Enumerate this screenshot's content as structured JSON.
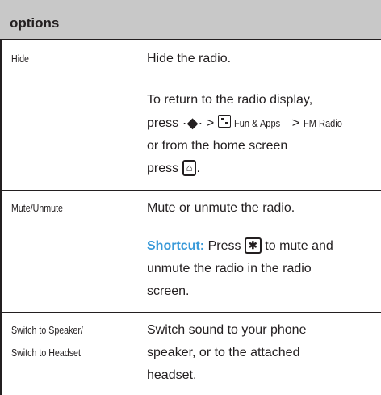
{
  "table": {
    "header": "options",
    "rows": [
      {
        "option": "Hide",
        "desc_1": "Hide the radio.",
        "desc_2_line1": "To return to the radio display,",
        "desc_2_press": "press",
        "desc_2_gt1": ">",
        "desc_2_fun": "Fun & Apps",
        "desc_2_gt2": ">",
        "desc_2_fm": "FM Radio",
        "desc_2_line3": "or from the home screen",
        "desc_2_line4_press": "press",
        "desc_2_line4_end": "."
      },
      {
        "option": "Mute/Unmute",
        "desc_1": "Mute or unmute the radio.",
        "shortcut_label": "Shortcut:",
        "shortcut_press": "Press",
        "shortcut_rest1": "to mute and",
        "shortcut_line2": "unmute the radio in the radio",
        "shortcut_line3": "screen."
      },
      {
        "option_line1": "Switch to Speaker/",
        "option_line2": "Switch to Headset",
        "desc_line1": "Switch sound to your phone",
        "desc_line2": "speaker, or to the attached",
        "desc_line3": "headset."
      }
    ]
  },
  "icons": {
    "nav_key": "navigation-key-icon",
    "fun_apps": "fun-apps-icon",
    "home_key": "home-key-icon",
    "star_key": "star-key-icon"
  },
  "colors": {
    "header_bg": "#c8c8c8",
    "shortcut": "#3a9ad9",
    "text": "#231f20"
  }
}
